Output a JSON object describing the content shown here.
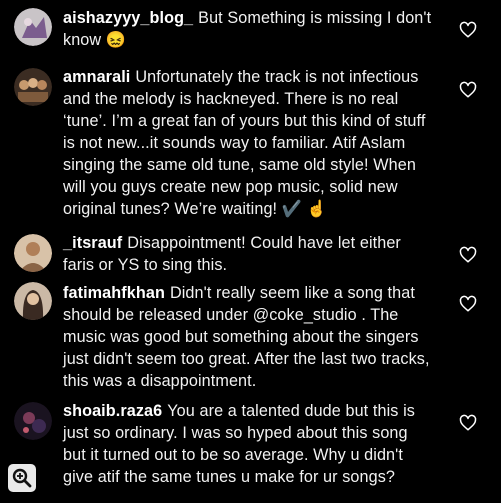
{
  "comments": [
    {
      "username": "aishazyyy_blog_",
      "body": "But Something is missing  I don't know 😖"
    },
    {
      "username": "amnarali",
      "body": "Unfortunately the track is not infectious and the melody is hackneyed. There is no real ‘tune’. I’m a great fan of yours but this kind of stuff is not new...it sounds way to familiar. Atif Aslam singing the same old tune, same old style! When will you guys create new pop music, solid new original tunes? We’re waiting! ✔️ ☝️"
    },
    {
      "username": "_itsrauf",
      "body": "Disappointment! Could have let either faris or YS to sing this."
    },
    {
      "username": "fatimahfkhan",
      "body": "Didn't really seem like a song that should be released under @coke_studio . The music was good but something about the singers just didn't seem too great. After the last two tracks, this was a disappointment."
    },
    {
      "username": "shoaib.raza6",
      "body": "You are a talented dude but this is just so ordinary. I was so hyped about this song but it turned out to be so average. Why u didn't give atif the same tunes u make for ur songs?"
    }
  ],
  "icons": {
    "like": "heart-outline-icon",
    "zoom": "zoom-magnifier-icon"
  },
  "colors": {
    "background": "#000000",
    "text": "#f2f2f2"
  }
}
